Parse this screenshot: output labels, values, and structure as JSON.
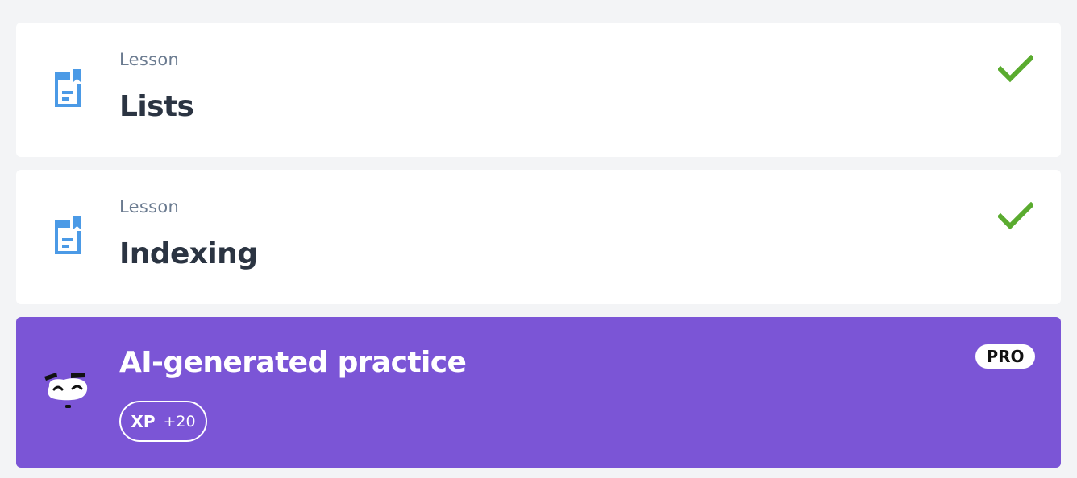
{
  "colors": {
    "background": "#f3f4f6",
    "card": "#ffffff",
    "lesson_icon": "#4b9ae6",
    "check": "#5aab2f",
    "practice_bg": "#7b55d6",
    "title_text": "#2b3442",
    "kicker_text": "#6b7b90"
  },
  "lessons": [
    {
      "kicker": "Lesson",
      "title": "Lists",
      "icon": "document-icon",
      "status_icon": "check-icon"
    },
    {
      "kicker": "Lesson",
      "title": "Indexing",
      "icon": "document-icon",
      "status_icon": "check-icon"
    }
  ],
  "practice": {
    "title": "AI-generated practice",
    "icon": "bot-icon",
    "xp_label": "XP",
    "xp_value": "+20",
    "pro_label": "PRO"
  }
}
